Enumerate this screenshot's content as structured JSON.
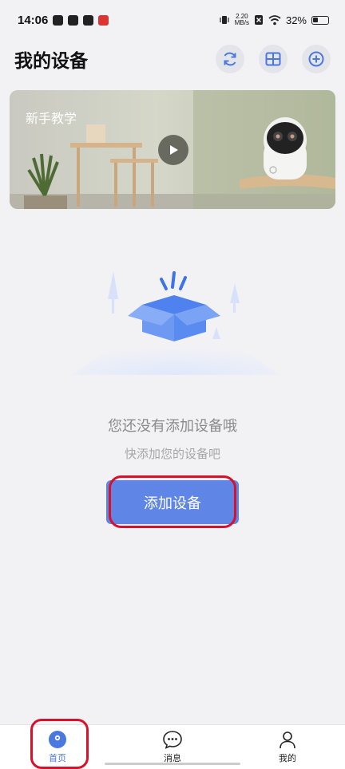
{
  "status_bar": {
    "time": "14:06",
    "net_speed_value": "2.20",
    "net_speed_unit": "MB/s",
    "battery": "32%"
  },
  "header": {
    "title": "我的设备",
    "actions": [
      "refresh-icon",
      "grid-view-icon",
      "add-circle-icon"
    ]
  },
  "banner": {
    "label": "新手教学"
  },
  "empty_state": {
    "title": "您还没有添加设备哦",
    "subtitle": "快添加您的设备吧",
    "button_label": "添加设备"
  },
  "tabbar": {
    "items": [
      {
        "label": "首页",
        "icon": "home-camera-icon",
        "active": true
      },
      {
        "label": "消息",
        "icon": "message-icon",
        "active": false
      },
      {
        "label": "我的",
        "icon": "profile-icon",
        "active": false
      }
    ]
  },
  "colors": {
    "accent": "#5f86e6",
    "active_tab": "#4a78e0",
    "highlight": "#d8102a",
    "background": "#f2f2f5"
  }
}
